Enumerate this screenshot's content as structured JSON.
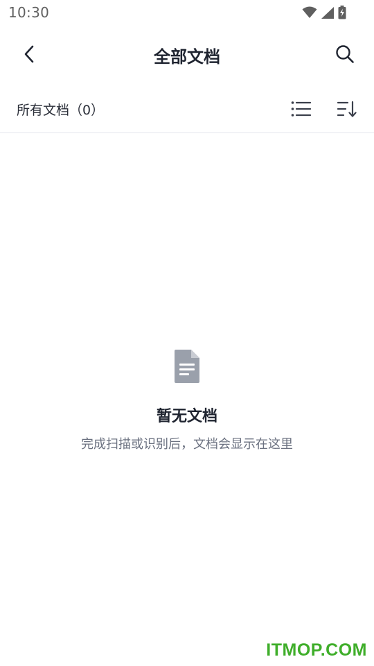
{
  "status_bar": {
    "time": "10:30",
    "icons": [
      "wifi-icon",
      "cellular-signal-icon",
      "battery-charging-icon"
    ]
  },
  "header": {
    "title": "全部文档",
    "back_icon": "chevron-left-icon",
    "search_icon": "search-icon"
  },
  "filter_bar": {
    "count_label": "所有文档（0）",
    "list_icon": "list-view-icon",
    "sort_icon": "sort-icon"
  },
  "empty_state": {
    "icon": "document-icon",
    "title": "暂无文档",
    "description": "完成扫描或识别后，文档会显示在这里"
  },
  "watermark": {
    "text": "ITMOP.COM"
  },
  "colors": {
    "text_primary": "#1f2430",
    "text_secondary": "#6b7180",
    "icon_gray": "#9aa0ab",
    "divider": "#e3e5ec",
    "watermark_green": "#3fae2a"
  }
}
